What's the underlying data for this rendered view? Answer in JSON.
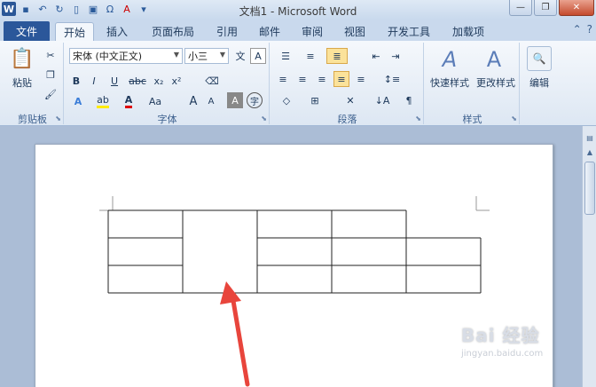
{
  "window": {
    "title": "文档1 - Microsoft Word"
  },
  "tabs": [
    {
      "label": "文件"
    },
    {
      "label": "开始"
    },
    {
      "label": "插入"
    },
    {
      "label": "页面布局"
    },
    {
      "label": "引用"
    },
    {
      "label": "邮件"
    },
    {
      "label": "审阅"
    },
    {
      "label": "视图"
    },
    {
      "label": "开发工具"
    },
    {
      "label": "加载项"
    }
  ],
  "ribbon": {
    "clipboard": {
      "label": "剪贴板",
      "paste": "粘贴"
    },
    "font": {
      "label": "字体",
      "font_name": "宋体 (中文正文)",
      "font_size": "小三"
    },
    "paragraph": {
      "label": "段落"
    },
    "styles": {
      "label": "样式",
      "quick_styles": "快速样式",
      "change_styles": "更改样式"
    },
    "editing": {
      "label": "编辑"
    }
  },
  "watermark": {
    "line1": "Bai 经验",
    "line2": "jingyan.baidu.com"
  },
  "table": {
    "rows": 3,
    "cols": 5
  },
  "colors": {
    "file_tab": "#2b579a",
    "arrow": "#e8453c"
  }
}
